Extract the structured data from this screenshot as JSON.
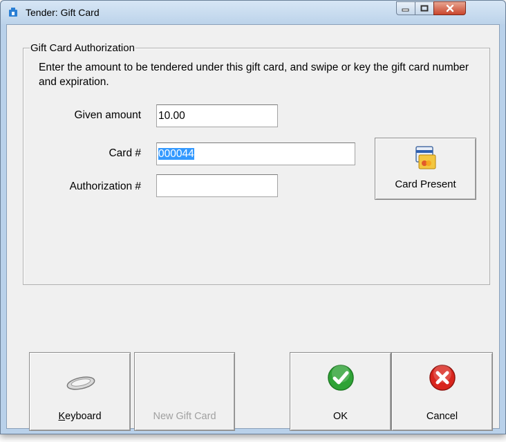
{
  "window": {
    "title": "Tender: Gift Card"
  },
  "group": {
    "title": "Gift Card Authorization",
    "instructions": "Enter the amount to be tendered under this gift card, and swipe or key the gift card number and expiration."
  },
  "form": {
    "given_amount_label": "Given amount",
    "given_amount_value": "10.00",
    "card_label": "Card #",
    "card_value": "000044",
    "authorization_label": "Authorization #",
    "authorization_value": ""
  },
  "buttons": {
    "card_present": "Card Present",
    "keyboard": "Keyboard",
    "new_gift_card": "New Gift Card",
    "ok": "OK",
    "cancel": "Cancel"
  },
  "colors": {
    "selection": "#3399ff",
    "ok_green": "#2fa336",
    "cancel_red": "#d9251d"
  }
}
